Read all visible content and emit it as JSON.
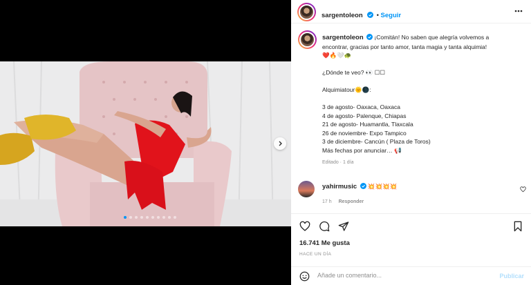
{
  "post": {
    "username": "sargentoleon",
    "follow_label": "Seguir",
    "more_icon": "more-horizontal-icon"
  },
  "caption": {
    "username": "sargentoleon",
    "lines": [
      "¡Comitán! No saben que alegría volvemos a",
      "encontrar, gracias por tanto amor, tanta magia y tanta alquimia!",
      "❤️🔥🤍🐢",
      "",
      "¿Dónde te veo? 👀 ☐☐",
      "",
      "Alquimiatour🌞🌑:",
      "",
      "3 de agosto- Oaxaca, Oaxaca",
      "4 de agosto- Palenque, Chiapas",
      "21 de agosto- Huamantla, Tlaxcala",
      "26 de noviembre- Expo Tampico",
      "3 de diciembre- Cancún ( Plaza de Toros)",
      "Más fechas por anunciar… 📢"
    ],
    "edited": "Editado · 1 día"
  },
  "comment": {
    "username": "yahirmusic",
    "text": "💥💥💥💥",
    "time": "17 h",
    "reply_label": "Responder"
  },
  "stats": {
    "likes": "16.741 Me gusta",
    "ago": "HACE UN DÍA"
  },
  "composer": {
    "placeholder": "Añade un comentario...",
    "post_label": "Publicar"
  },
  "carousel": {
    "slides": 10,
    "active": 0
  },
  "colors": {
    "accent": "#0095f6",
    "verified": "#0095f6",
    "outfit": "#e1131b",
    "boots": "#d6a51f",
    "chair": "#e8c7c9"
  }
}
